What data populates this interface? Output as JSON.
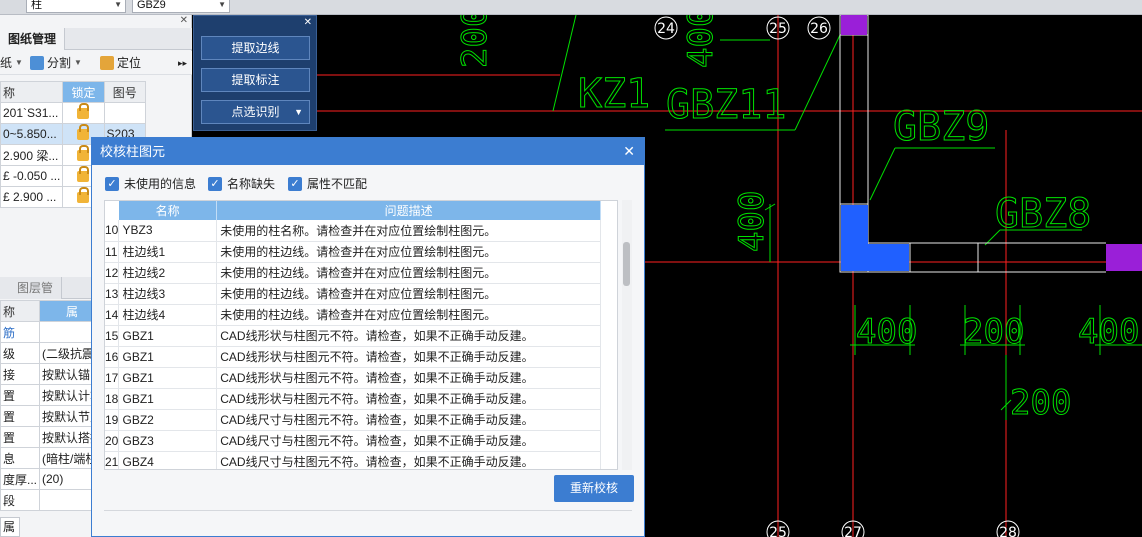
{
  "topbar": {
    "combo1": "柱",
    "combo2": "GBZ9"
  },
  "left": {
    "drawing_tab": "图纸管理",
    "tools": [
      "纸",
      "分割",
      "定位"
    ],
    "headers": [
      "称",
      "锁定",
      "图号"
    ],
    "rows": [
      {
        "name": "201`S31...",
        "code": ""
      },
      {
        "name": "0~5.850...",
        "code": "S203"
      },
      {
        "name": "2.900  梁...",
        "code": ""
      },
      {
        "name": "£ -0.050 ...",
        "code": ""
      },
      {
        "name": "£ 2.900  ...",
        "code": ""
      }
    ],
    "layer_tab_left": "图层管理",
    "prop_header": [
      "称",
      "属"
    ],
    "props": [
      {
        "k": "筋",
        "v": ""
      },
      {
        "k": "级",
        "v": "(二级抗震)"
      },
      {
        "k": "接",
        "v": "按默认锚固"
      },
      {
        "k": "置",
        "v": "按默认计算"
      },
      {
        "k": "置",
        "v": "按默认节点"
      },
      {
        "k": "置",
        "v": "按默认搭接"
      },
      {
        "k": "息",
        "v": "(暗柱/端柱)"
      },
      {
        "k": "度厚...",
        "v": "(20)"
      },
      {
        "k": "段",
        "v": ""
      }
    ],
    "bottom_tab": "属"
  },
  "cad_panel": {
    "btn1": "提取边线",
    "btn2": "提取标注",
    "btn3": "点选识别"
  },
  "dialog": {
    "title": "校核柱图元",
    "cb1": "未使用的信息",
    "cb2": "名称缺失",
    "cb3": "属性不匹配",
    "col_name": "名称",
    "col_desc": "问题描述",
    "rows": [
      {
        "n": "10",
        "name": "YBZ3",
        "desc": "未使用的柱名称。请检查并在对应位置绘制柱图元。"
      },
      {
        "n": "11",
        "name": "柱边线1",
        "desc": "未使用的柱边线。请检查并在对应位置绘制柱图元。"
      },
      {
        "n": "12",
        "name": "柱边线2",
        "desc": "未使用的柱边线。请检查并在对应位置绘制柱图元。"
      },
      {
        "n": "13",
        "name": "柱边线3",
        "desc": "未使用的柱边线。请检查并在对应位置绘制柱图元。"
      },
      {
        "n": "14",
        "name": "柱边线4",
        "desc": "未使用的柱边线。请检查并在对应位置绘制柱图元。"
      },
      {
        "n": "15",
        "name": "GBZ1",
        "desc": "CAD线形状与柱图元不符。请检查，如果不正确手动反建。"
      },
      {
        "n": "16",
        "name": "GBZ1",
        "desc": "CAD线形状与柱图元不符。请检查，如果不正确手动反建。"
      },
      {
        "n": "17",
        "name": "GBZ1",
        "desc": "CAD线形状与柱图元不符。请检查，如果不正确手动反建。"
      },
      {
        "n": "18",
        "name": "GBZ1",
        "desc": "CAD线形状与柱图元不符。请检查，如果不正确手动反建。"
      },
      {
        "n": "19",
        "name": "GBZ2",
        "desc": "CAD线尺寸与柱图元不符。请检查，如果不正确手动反建。"
      },
      {
        "n": "20",
        "name": "GBZ3",
        "desc": "CAD线尺寸与柱图元不符。请检查，如果不正确手动反建。"
      },
      {
        "n": "21",
        "name": "GBZ4",
        "desc": "CAD线尺寸与柱图元不符。请检查，如果不正确手动反建。"
      }
    ],
    "recheck": "重新校核"
  },
  "cad": {
    "axes": [
      "24",
      "25",
      "26",
      "25",
      "27",
      "28"
    ],
    "labels": [
      "KZ1",
      "GBZ11",
      "GBZ9",
      "GBZ8",
      "200",
      "400",
      "400",
      "200",
      "400",
      "200"
    ]
  },
  "colors": {
    "accent": "#3c7dd1",
    "cad_line": "#00e000",
    "grid_line": "#ff2020",
    "column_fill": "#2060ff",
    "magenta": "#9a1fd8"
  }
}
